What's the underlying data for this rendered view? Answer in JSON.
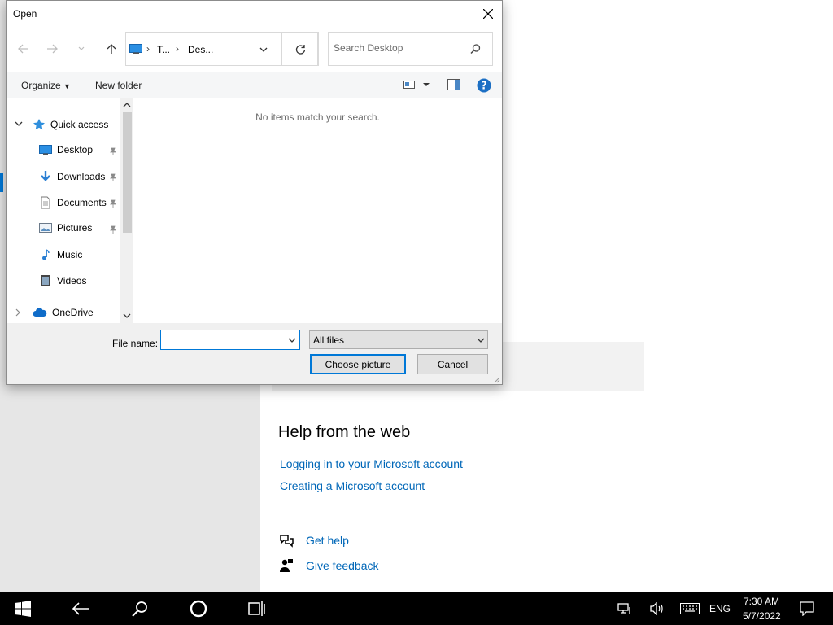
{
  "settings_page": {
    "help_title": "Help from the web",
    "web_links": [
      "Logging in to your Microsoft account",
      "Creating a Microsoft account"
    ],
    "get_help": "Get help",
    "give_feedback": "Give feedback"
  },
  "dialog": {
    "title": "Open",
    "address": {
      "crumbs": [
        "T...",
        "Des..."
      ]
    },
    "search": {
      "placeholder": "Search Desktop"
    },
    "toolbar": {
      "organize": "Organize",
      "new_folder": "New folder"
    },
    "nav": {
      "quick_access": "Quick access",
      "items": [
        {
          "label": "Desktop",
          "icon": "desktop-icon",
          "pinned": true
        },
        {
          "label": "Downloads",
          "icon": "downloads-icon",
          "pinned": true
        },
        {
          "label": "Documents",
          "icon": "documents-icon",
          "pinned": true
        },
        {
          "label": "Pictures",
          "icon": "pictures-icon",
          "pinned": true
        },
        {
          "label": "Music",
          "icon": "music-icon",
          "pinned": false
        },
        {
          "label": "Videos",
          "icon": "videos-icon",
          "pinned": false
        }
      ],
      "onedrive": "OneDrive"
    },
    "empty_message": "No items match your search.",
    "file_name_label": "File name:",
    "file_name_value": "",
    "file_type": "All files",
    "primary_button": "Choose picture",
    "cancel_button": "Cancel"
  },
  "taskbar": {
    "language": "ENG",
    "time": "7:30 AM",
    "date": "5/7/2022"
  },
  "colors": {
    "accent": "#0078d7",
    "link": "#0067b8"
  }
}
